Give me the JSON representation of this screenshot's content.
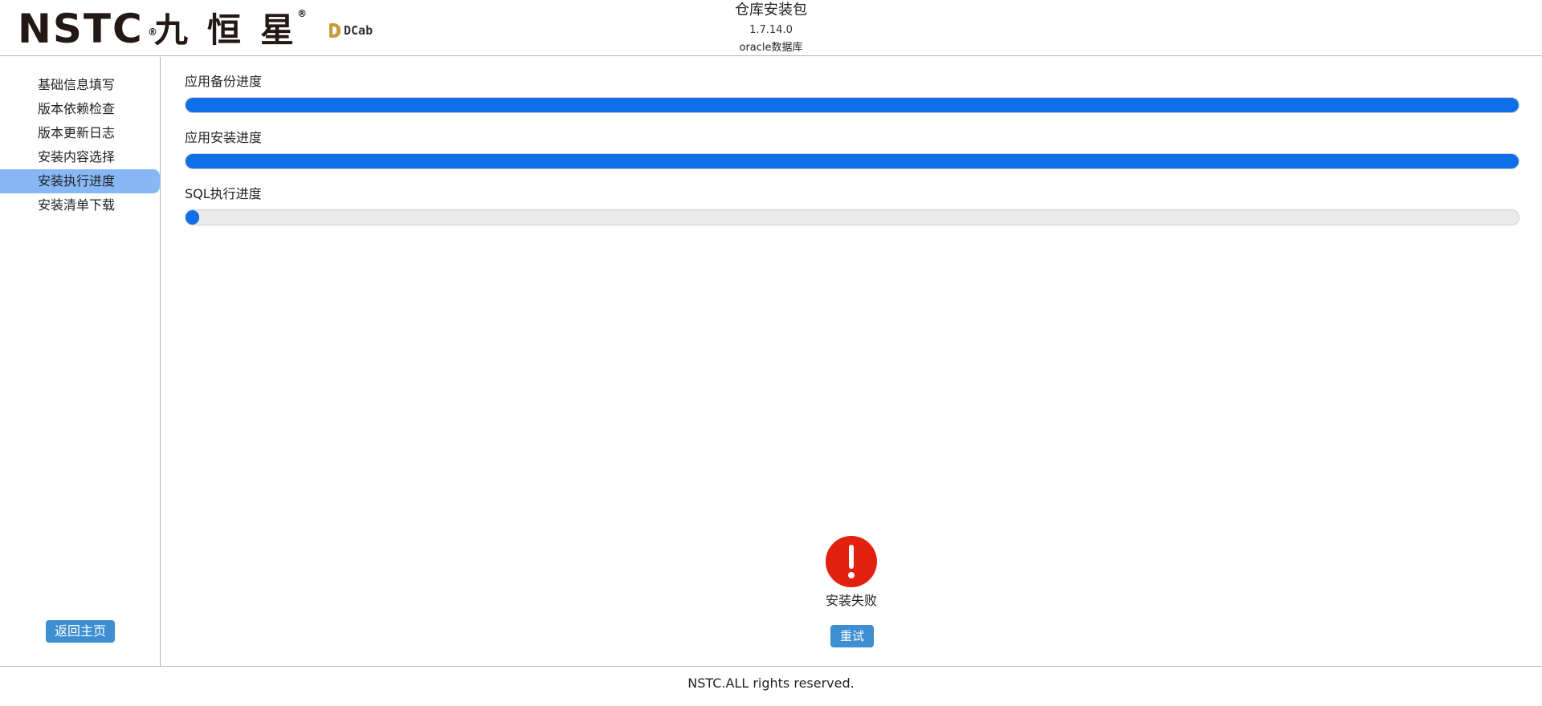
{
  "header": {
    "logo_text_nstc": "NSTC",
    "logo_text_cn": "九恒星",
    "logo_reg_mark": "®",
    "logo_dcab": "DCab",
    "title": "仓库安装包",
    "version": "1.7.14.0",
    "database": "oracle数据库"
  },
  "sidebar": {
    "items": [
      {
        "label": "基础信息填写"
      },
      {
        "label": "版本依赖检查"
      },
      {
        "label": "版本更新日志"
      },
      {
        "label": "安装内容选择"
      },
      {
        "label": "安装执行进度",
        "active": true
      },
      {
        "label": "安装清单下载"
      }
    ],
    "back_button_label": "返回主页"
  },
  "progress": [
    {
      "label": "应用备份进度",
      "percent": 100
    },
    {
      "label": "应用安装进度",
      "percent": 100
    },
    {
      "label": "SQL执行进度",
      "percent": 1
    }
  ],
  "status": {
    "icon": "error-icon",
    "message": "安装失败",
    "retry_button_label": "重试"
  },
  "footer": {
    "text": "NSTC.ALL rights reserved."
  },
  "colors": {
    "progress_fill": "#0e6fe6",
    "active_nav": "#87b8f5",
    "button": "#3d8fd1",
    "error": "#e2200f",
    "logo_accent": "#e60012",
    "dcab_gold": "#c89a3b"
  }
}
